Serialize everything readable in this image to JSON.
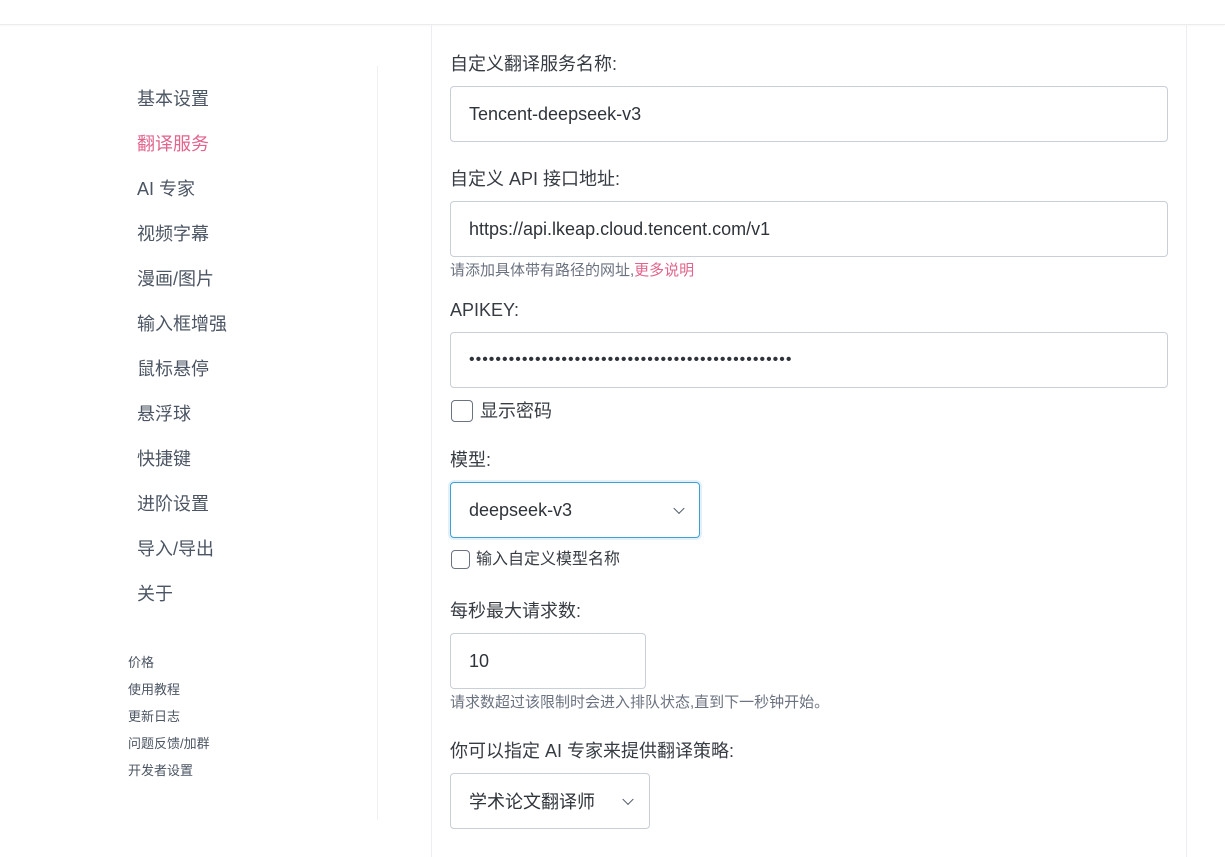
{
  "sidebar": {
    "items": [
      {
        "label": "基本设置"
      },
      {
        "label": "翻译服务",
        "active": true
      },
      {
        "label": "AI 专家"
      },
      {
        "label": "视频字幕"
      },
      {
        "label": "漫画/图片"
      },
      {
        "label": "输入框增强"
      },
      {
        "label": "鼠标悬停"
      },
      {
        "label": "悬浮球"
      },
      {
        "label": "快捷键"
      },
      {
        "label": "进阶设置"
      },
      {
        "label": "导入/导出"
      },
      {
        "label": "关于"
      }
    ],
    "links": [
      {
        "label": "价格"
      },
      {
        "label": "使用教程"
      },
      {
        "label": "更新日志"
      },
      {
        "label": "问题反馈/加群"
      },
      {
        "label": "开发者设置"
      }
    ]
  },
  "form": {
    "service_name": {
      "label": "自定义翻译服务名称:",
      "value": "Tencent-deepseek-v3"
    },
    "api_url": {
      "label": "自定义 API 接口地址:",
      "value": "https://api.lkeap.cloud.tencent.com/v1",
      "help": "请添加具体带有路径的网址,",
      "help_link": "更多说明"
    },
    "apikey": {
      "label": "APIKEY:",
      "value": "•••••••••••••••••••••••••••••••••••••••••••••••••",
      "show_password_label": "显示密码",
      "show_password_checked": false
    },
    "model": {
      "label": "模型:",
      "selected": "deepseek-v3",
      "custom_model_label": "输入自定义模型名称",
      "custom_model_checked": false
    },
    "max_requests": {
      "label": "每秒最大请求数:",
      "value": "10",
      "help": "请求数超过该限制时会进入排队状态,直到下一秒钟开始。"
    },
    "ai_expert": {
      "label": "你可以指定 AI 专家来提供翻译策略:",
      "selected": "学术论文翻译师"
    }
  },
  "colors": {
    "accent": "#e2638b",
    "focus_border": "#3ea0d4",
    "text": "#373c43",
    "muted": "#6b7280"
  }
}
